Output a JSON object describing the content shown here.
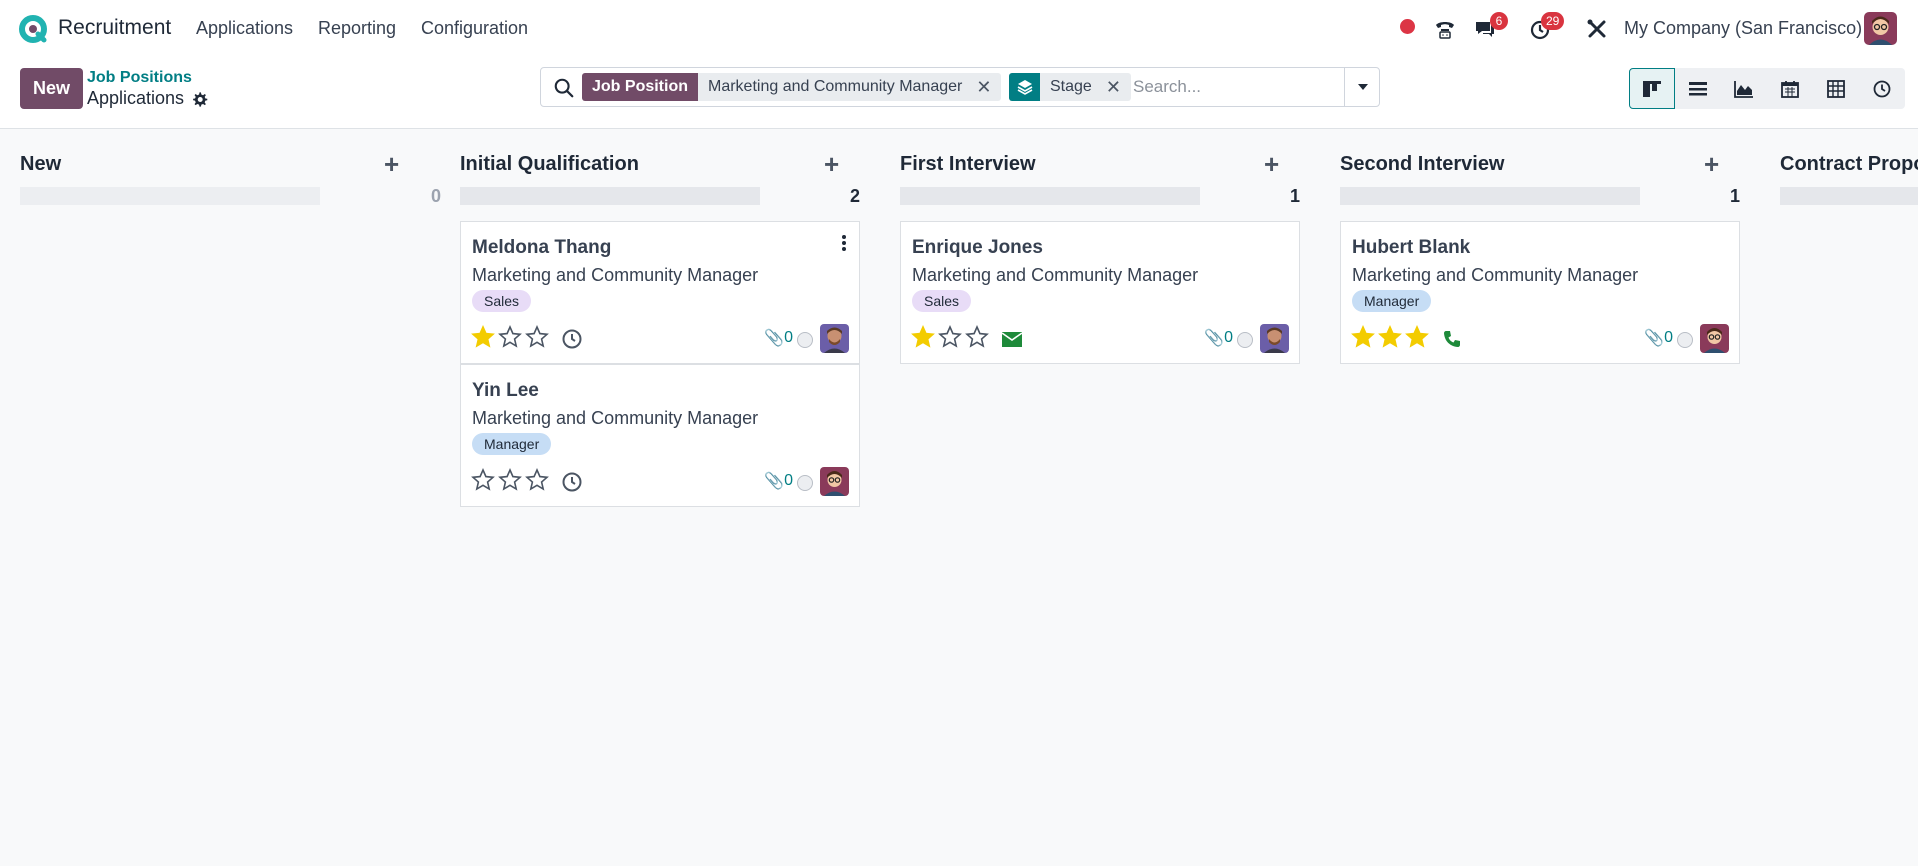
{
  "navbar": {
    "app_name": "Recruitment",
    "menu": [
      "Applications",
      "Reporting",
      "Configuration"
    ],
    "messages_count": "6",
    "activities_count": "29",
    "company": "My Company (San Francisco)"
  },
  "control": {
    "new_label": "New",
    "breadcrumb_parent": "Job Positions",
    "breadcrumb_current": "Applications",
    "search": {
      "facet1_label": "Job Position",
      "facet1_value": "Marketing and Community Manager",
      "facet2_value": "Stage",
      "placeholder": "Search..."
    },
    "active_view": "kanban"
  },
  "columns": [
    {
      "title": "New",
      "count": "0"
    },
    {
      "title": "Initial Qualification",
      "count": "2"
    },
    {
      "title": "First Interview",
      "count": "1"
    },
    {
      "title": "Second Interview",
      "count": "1"
    },
    {
      "title": "Contract Proposal"
    }
  ],
  "cards": [
    {
      "name": "Meldona Thang",
      "job": "Marketing and Community Manager",
      "tag": "Sales",
      "stars": 1,
      "attachments": "0",
      "activity": "clock-icon"
    },
    {
      "name": "Yin Lee",
      "job": "Marketing and Community Manager",
      "tag": "Manager",
      "stars": 0,
      "attachments": "0",
      "activity": "clock-icon"
    },
    {
      "name": "Enrique Jones",
      "job": "Marketing and Community Manager",
      "tag": "Sales",
      "stars": 1,
      "attachments": "0",
      "activity": "envelope-icon"
    },
    {
      "name": "Hubert Blank",
      "job": "Marketing and Community Manager",
      "tag": "Manager",
      "stars": 3,
      "attachments": "0",
      "activity": "phone-icon"
    }
  ],
  "colors": {
    "brand": "#714b67",
    "accent": "#017e84",
    "star": "#f3cc00"
  }
}
